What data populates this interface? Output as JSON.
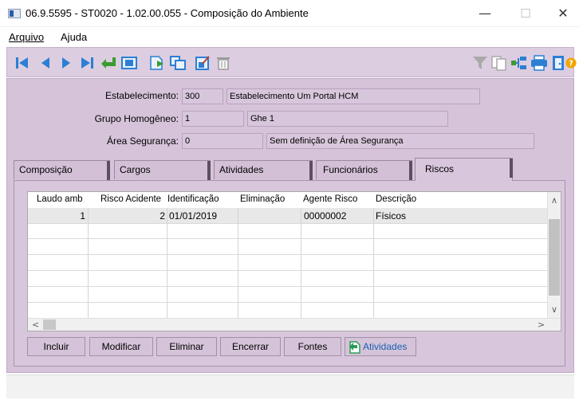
{
  "window": {
    "title": "06.9.5595 - ST0020 - 1.02.00.055 - Composição do Ambiente",
    "minimize": "—",
    "maximize": "☐",
    "close": "✕"
  },
  "menu": {
    "arquivo": "Arquivo",
    "ajuda_a": "A",
    "ajuda_j": "j",
    "ajuda_rest": "uda"
  },
  "toolbar": {
    "icons": [
      "first-record-icon",
      "previous-record-icon",
      "next-record-icon",
      "last-record-icon",
      "return-icon",
      "view-icon",
      "new-document-icon",
      "copy-icon",
      "edit-icon",
      "delete-icon",
      "filter-icon",
      "documents-icon",
      "tree-icon",
      "print-icon",
      "exit-icon",
      "help-icon"
    ]
  },
  "form": {
    "estabelecimento_label": "Estabelecimento:",
    "estabelecimento_code": "300",
    "estabelecimento_name": "Estabelecimento Um Portal HCM",
    "grupo_label": "Grupo Homogêneo:",
    "grupo_code": "1",
    "grupo_name": "Ghe 1",
    "area_label": "Área Segurança:",
    "area_code": "0",
    "area_name": "Sem definição de Área Segurança"
  },
  "tabs": {
    "composicao": "Composição",
    "cargos": "Cargos",
    "atividades": "Atividades",
    "funcionarios": "Funcionários",
    "riscos": "Riscos"
  },
  "grid": {
    "columns": [
      "Laudo amb",
      "Risco Acidente",
      "Identificação",
      "Eliminação",
      "Agente Risco",
      "Descrição"
    ],
    "rows": [
      {
        "laudo_amb": "1",
        "risco_acidente": "2",
        "identificacao": "01/01/2019",
        "eliminacao": "",
        "agente_risco": "00000002",
        "descricao": "Físicos"
      }
    ],
    "scroll_up": "∧",
    "scroll_down": "∨",
    "scroll_left": "<",
    "scroll_right": ">"
  },
  "buttons": {
    "incluir": "Incluir",
    "modificar": "Modificar",
    "eliminar": "Eliminar",
    "encerrar": "Encerrar",
    "fontes": "Fontes",
    "atividades": "Atividades"
  },
  "colors": {
    "panel": "#d6c3da",
    "toolbar": "#dccde0",
    "icon_blue": "#2b7fd4",
    "link_blue": "#1a5fb4"
  }
}
